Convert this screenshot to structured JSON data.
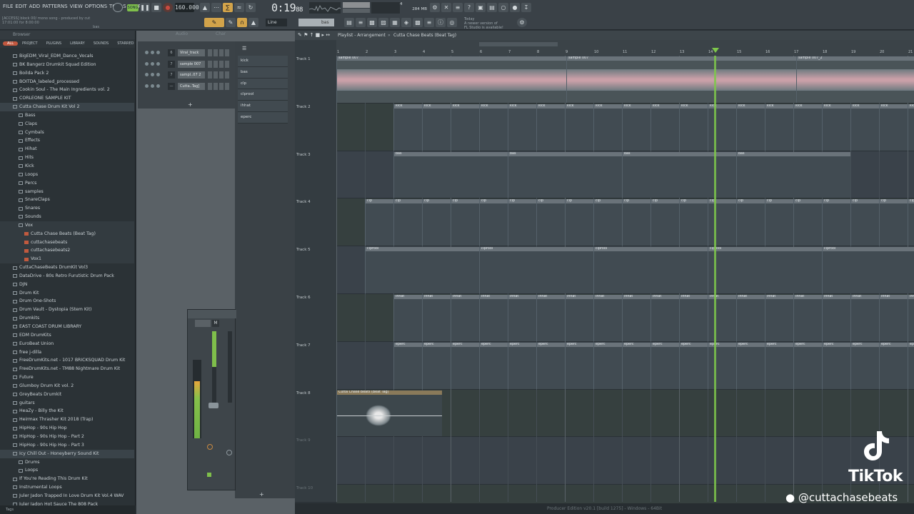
{
  "menu": [
    "FILE",
    "EDIT",
    "ADD",
    "PATTERNS",
    "VIEW",
    "OPTIONS",
    "TOOLS",
    "HELP"
  ],
  "hint": {
    "line1": "[ACCESS] block 00/ mono song - produced by cut",
    "line2": "17:01:00 for 8:00:00",
    "line3": "bas"
  },
  "transport": {
    "tempo": "160.000",
    "time": "0:19",
    "time_frac": "88",
    "cpu": "284 MB",
    "cpu2": "4",
    "pattern": "bas",
    "snap": "Line"
  },
  "news": {
    "line1": "Today",
    "line2": "A newer version of",
    "line3": "FL Studio is available!"
  },
  "browser": {
    "title": "Browser",
    "tabs": [
      "ALL",
      "PROJECT",
      "PLUGINS",
      "LIBRARY",
      "SOUNDS",
      "STARRED"
    ],
    "items": [
      {
        "label": "BigEDM_Viral_EDM_Dance_Vocals",
        "indent": 2
      },
      {
        "label": "BK Bangerz Drumkit Squad Edition",
        "indent": 2
      },
      {
        "label": "Boilda Pack 2",
        "indent": 2
      },
      {
        "label": "BOITDA_labeled_processed",
        "indent": 2
      },
      {
        "label": "Cookin Soul - The Main Ingredients vol. 2",
        "indent": 2
      },
      {
        "label": "CORLEONE SAMPLE KIT",
        "indent": 2
      },
      {
        "label": "Cutta Chase Drum Kit Vol 2",
        "indent": 2,
        "sel": true
      },
      {
        "label": "Bass",
        "indent": 3
      },
      {
        "label": "Claps",
        "indent": 3
      },
      {
        "label": "Cymbals",
        "indent": 3
      },
      {
        "label": "Effects",
        "indent": 3
      },
      {
        "label": "Hihat",
        "indent": 3
      },
      {
        "label": "Hits",
        "indent": 3
      },
      {
        "label": "Kick",
        "indent": 3
      },
      {
        "label": "Loops",
        "indent": 3
      },
      {
        "label": "Percs",
        "indent": 3
      },
      {
        "label": "samples",
        "indent": 3
      },
      {
        "label": "SnareClaps",
        "indent": 3
      },
      {
        "label": "Snares",
        "indent": 3
      },
      {
        "label": "Sounds",
        "indent": 3
      },
      {
        "label": "Vox",
        "indent": 3,
        "hl": true
      },
      {
        "label": "Cutta Chase Beats (Beat Tag)",
        "indent": 4,
        "file": true,
        "hl": true
      },
      {
        "label": "cuttachasebeats",
        "indent": 4,
        "file": true,
        "hl": true
      },
      {
        "label": "cuttachasebeats2",
        "indent": 4,
        "file": true,
        "hl": true
      },
      {
        "label": "Vox1",
        "indent": 4,
        "file": true,
        "hl": true
      },
      {
        "label": "CuttaChaseBeats DrumKit Vol3",
        "indent": 2
      },
      {
        "label": "DataDrive - 80s Retro Furutistic Drum Pack",
        "indent": 2
      },
      {
        "label": "DJN",
        "indent": 2
      },
      {
        "label": "Drum Kit",
        "indent": 2
      },
      {
        "label": "Drum One-Shots",
        "indent": 2
      },
      {
        "label": "Drum Vault - Dystopia (Stem Kit)",
        "indent": 2
      },
      {
        "label": "Drumkits",
        "indent": 2
      },
      {
        "label": "EAST COAST DRUM LIBRARY",
        "indent": 2
      },
      {
        "label": "EDM DrumKits",
        "indent": 2
      },
      {
        "label": "EuroBeat Union",
        "indent": 2
      },
      {
        "label": "free j-dilla",
        "indent": 2
      },
      {
        "label": "FreeDrumKits.net - 1017 BRICKSQUAD Drum Kit",
        "indent": 2
      },
      {
        "label": "FreeDrumKits.net - TM88 Nightmare Drum Kit",
        "indent": 2
      },
      {
        "label": "Future",
        "indent": 2
      },
      {
        "label": "Glumboy Drum Kit vol. 2",
        "indent": 2
      },
      {
        "label": "GreyBeats Drumkit",
        "indent": 2
      },
      {
        "label": "guitars",
        "indent": 2
      },
      {
        "label": "HeaZy - Billy the Kit",
        "indent": 2
      },
      {
        "label": "Heirmax Thrasher Kit 2018 (Trap)",
        "indent": 2
      },
      {
        "label": "HipHop - 90s Hip Hop",
        "indent": 2
      },
      {
        "label": "HipHop - 90s Hip Hop - Part 2",
        "indent": 2
      },
      {
        "label": "HipHop - 90s Hip Hop - Part 3",
        "indent": 2
      },
      {
        "label": "Icy Chill Out - Honeyberry Sound Kit",
        "indent": 2,
        "sel": true
      },
      {
        "label": "Drums",
        "indent": 3
      },
      {
        "label": "Loops",
        "indent": 3
      },
      {
        "label": "If You're Reading This Drum Kit",
        "indent": 2
      },
      {
        "label": "Instrumental Loops",
        "indent": 2
      },
      {
        "label": "Juler Jadon Trapped In Love Drum Kit Vol.4 WAV",
        "indent": 2
      },
      {
        "label": "Juler Jadon Hot Sauce The 808 Pack",
        "indent": 2
      }
    ],
    "footer": "Tags"
  },
  "channels": [
    {
      "num": "6",
      "name": "Viral_track"
    },
    {
      "num": "7",
      "name": "sample 007"
    },
    {
      "num": "7",
      "name": "sampl..07 2"
    },
    {
      "num": "—",
      "name": "Cutta..Tag]"
    }
  ],
  "picker": [
    "kick",
    "bas",
    "clp",
    "clprool",
    "ihhat",
    "eperc"
  ],
  "playlist": {
    "title": "Playlist - Arrangement",
    "pattern": "Cutta Chase Beats (Beat Tag)",
    "bars": [
      "1",
      "2",
      "3",
      "4",
      "5",
      "6",
      "7",
      "8",
      "9",
      "10",
      "11",
      "12",
      "13",
      "14",
      "15",
      "16",
      "17",
      "18",
      "19",
      "20",
      "21"
    ],
    "tracks": [
      "Track 1",
      "Track 2",
      "Track 3",
      "Track 4",
      "Track 5",
      "Track 6",
      "Track 7",
      "Track 8",
      "Track 9",
      "Track 10"
    ],
    "audio_clips": {
      "t1a": "sample 007",
      "t1b": "sample 007",
      "t1c": "sample 007_2",
      "t8": "Cutta Chase Beats (Beat Tag)"
    },
    "pat": {
      "kick": "kick",
      "bas": "bas",
      "clp": "clp",
      "clprool": "clprool",
      "ihhat": "ihhat",
      "eperc": "eperc"
    }
  },
  "status": "Producer Edition v20.1 [build 1275] - Windows - 64Bit",
  "tiktok": {
    "word": "TikTok",
    "handle": "@cuttachasebeats"
  }
}
